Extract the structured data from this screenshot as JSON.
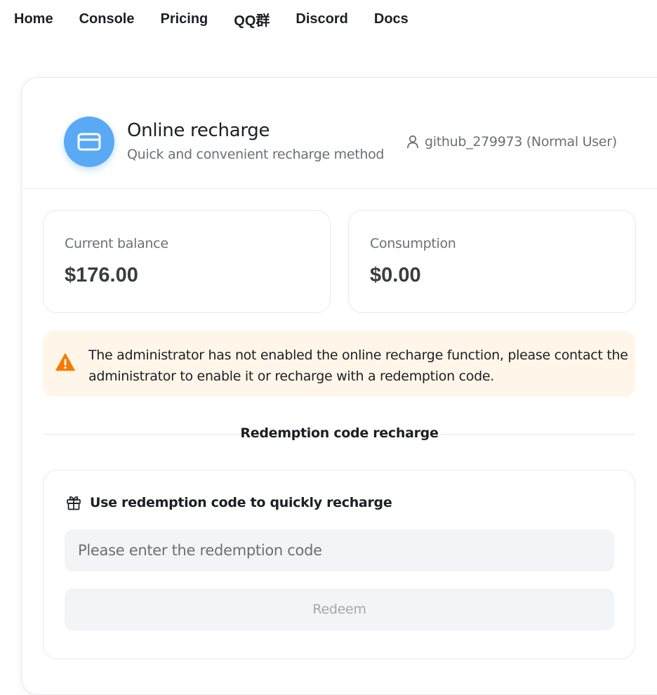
{
  "nav": {
    "items": [
      "Home",
      "Console",
      "Pricing",
      "QQ群",
      "Discord",
      "Docs"
    ]
  },
  "header": {
    "icon": "credit-card-icon",
    "title": "Online recharge",
    "subtitle": "Quick and convenient recharge method",
    "user_icon": "user-icon",
    "user": "github_279973 (Normal User)"
  },
  "stats": {
    "balance": {
      "label": "Current balance",
      "value": "$176.00"
    },
    "consumption": {
      "label": "Consumption",
      "value": "$0.00"
    }
  },
  "alert": {
    "icon": "warning-icon",
    "color": "#f57c00",
    "text": "The administrator has not enabled the online recharge function, please contact the administrator to enable it or recharge with a redemption code."
  },
  "divider": {
    "label": "Redemption code recharge"
  },
  "redeem": {
    "icon": "gift-icon",
    "title": "Use redemption code to quickly recharge",
    "placeholder": "Please enter the redemption code",
    "button": "Redeem"
  },
  "colors": {
    "accent": "#5aa9f5",
    "warning_bg": "#fff6e9"
  }
}
